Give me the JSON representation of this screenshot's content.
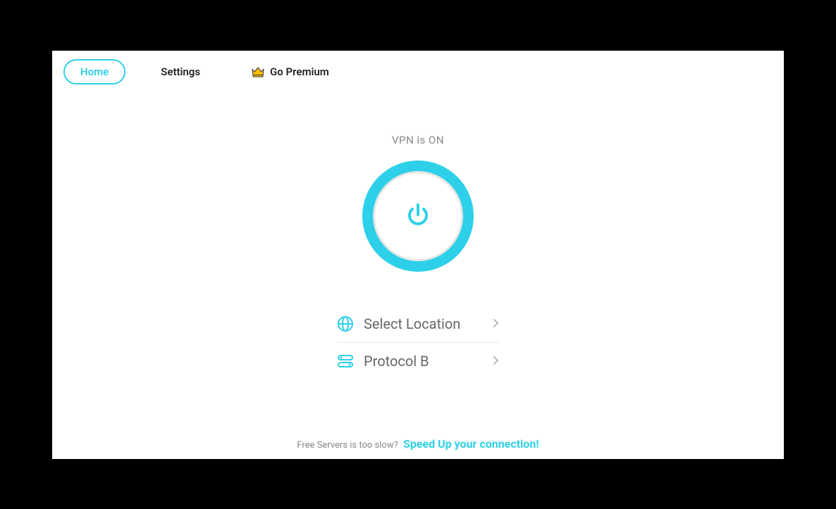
{
  "nav": {
    "home": "Home",
    "settings": "Settings",
    "premium": "Go Premium"
  },
  "status": {
    "label": "VPN is ON"
  },
  "options": {
    "location": {
      "label": "Select Location"
    },
    "protocol": {
      "label": "Protocol B"
    }
  },
  "footer": {
    "prompt": "Free Servers is too slow?",
    "cta": "Speed Up your connection!"
  },
  "colors": {
    "accent": "#2dd0e8"
  }
}
